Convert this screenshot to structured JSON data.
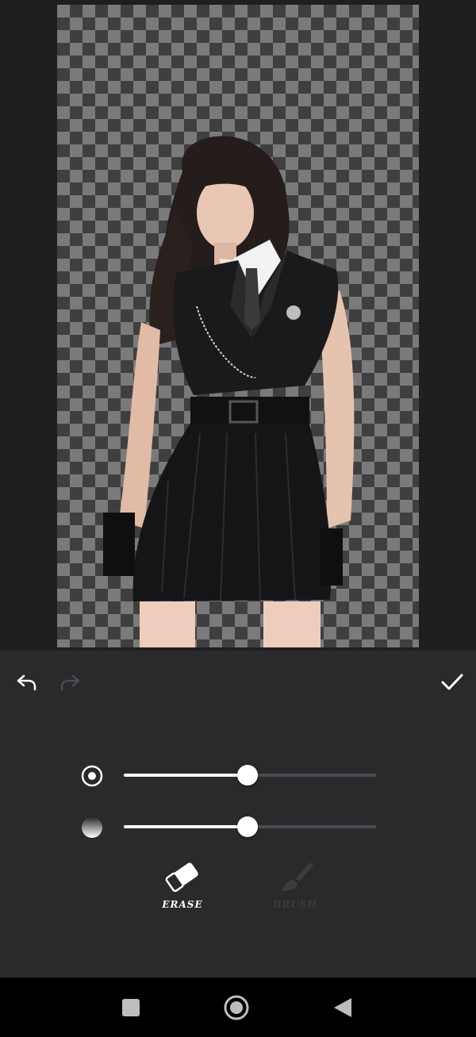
{
  "editor": {
    "mode": "erase",
    "modes": [
      {
        "id": "erase",
        "label": "ERASE",
        "icon": "eraser-icon",
        "active": true
      },
      {
        "id": "brush",
        "label": "BRUSH",
        "icon": "brush-icon",
        "active": false
      }
    ]
  },
  "toolbar": {
    "undo_icon": "undo-icon",
    "redo_icon": "redo-icon",
    "redo_enabled": false,
    "done_icon": "checkmark-icon"
  },
  "sliders": {
    "brush_size": {
      "icon": "brush-size-icon",
      "value_fraction": 0.49
    },
    "hardness": {
      "icon": "brush-hardness-icon",
      "value_fraction": 0.49
    }
  },
  "navbar": {
    "buttons": [
      "recents-icon",
      "home-icon",
      "back-icon"
    ]
  },
  "colors": {
    "background": "#1f1f22",
    "panel": "#2a2a2d",
    "accent": "#ffffff",
    "inactive": "#3c3c3f",
    "checker_dark": "#3f3f3f",
    "checker_light": "#7a7a7a"
  }
}
